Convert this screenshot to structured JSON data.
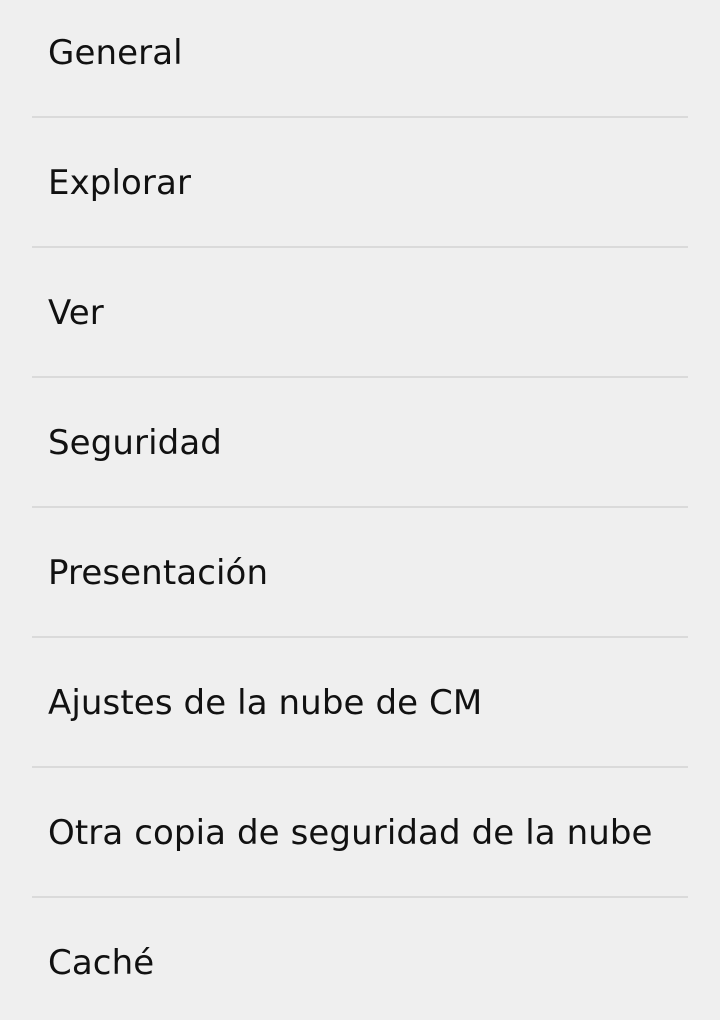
{
  "settings": {
    "items": [
      {
        "label": "General"
      },
      {
        "label": "Explorar"
      },
      {
        "label": "Ver"
      },
      {
        "label": "Seguridad"
      },
      {
        "label": "Presentación"
      },
      {
        "label": "Ajustes de la nube de CM"
      },
      {
        "label": "Otra copia de seguridad de la nube"
      },
      {
        "label": "Caché"
      }
    ]
  }
}
